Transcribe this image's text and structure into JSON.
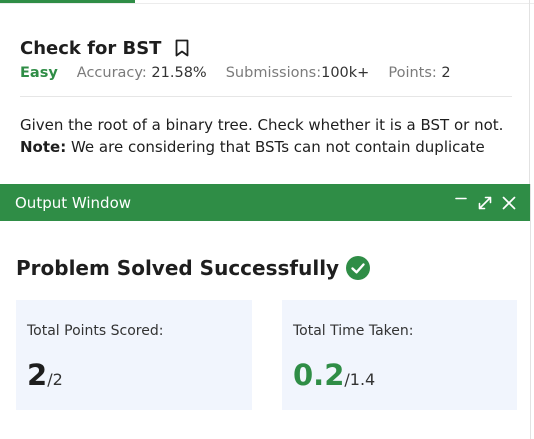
{
  "problem": {
    "title": "Check for BST",
    "difficulty": "Easy",
    "accuracy_label": "Accuracy:",
    "accuracy_value": "21.58%",
    "submissions_label": "Submissions:",
    "submissions_value": "100k+",
    "points_label": "Points:",
    "points_value": "2",
    "description_line1": "Given the root of a binary tree. Check whether it is a BST or not.",
    "note_label": "Note:",
    "note_text": " We are considering that BSTs can not contain duplicate"
  },
  "output_window": {
    "title": "Output Window",
    "status": "Problem Solved Successfully",
    "points_card": {
      "label": "Total Points Scored:",
      "value": "2",
      "total": "/2"
    },
    "time_card": {
      "label": "Total Time Taken:",
      "value": "0.2",
      "total": "/1.4"
    }
  },
  "colors": {
    "accent": "#2f8d46",
    "card_bg": "#f1f5fd",
    "text": "#1e1e1e",
    "muted": "#7b7b7b"
  },
  "icons": [
    "bookmark-icon",
    "minimize-icon",
    "expand-icon",
    "close-icon",
    "check-circle-icon"
  ]
}
